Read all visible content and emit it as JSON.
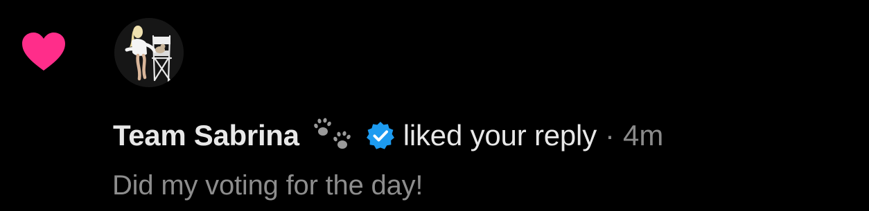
{
  "notification": {
    "status_icon": "heart-icon",
    "status_color": "#ff2d8a",
    "avatar": "profile-avatar",
    "username": "Team Sabrina",
    "username_badge_icon": "paw-prints-icon",
    "verified_icon": "verified-badge-icon",
    "verified_color": "#1d9bf0",
    "action_text": "liked your reply",
    "separator": "·",
    "timestamp": "4m",
    "reply_text": "Did my voting for the day!"
  }
}
